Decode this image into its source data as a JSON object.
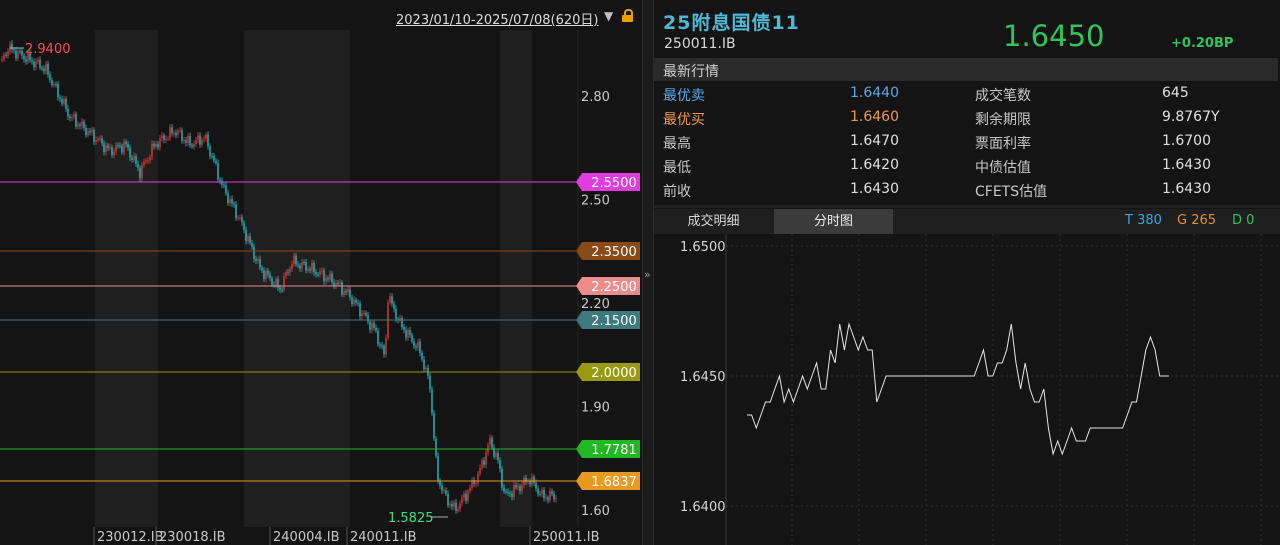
{
  "kline_chart": {
    "header_range": "2023/01/10-2025/07/08(620日)",
    "y_ticks": [
      "2.80",
      "2.50",
      "2.20",
      "1.90",
      "1.60"
    ],
    "x_ticks": [
      "230012.IB",
      "230018.IB",
      "240004.IB",
      "240011.IB",
      "250011.IB"
    ],
    "high_label": "2.9400",
    "low_label": "1.5825",
    "levels": [
      {
        "value": "2.5500",
        "color": "#e23be0"
      },
      {
        "value": "2.3500",
        "color": "#8a4a18"
      },
      {
        "value": "2.2500",
        "color": "#ee8c8c"
      },
      {
        "value": "2.1500",
        "color": "#3c7a7e"
      },
      {
        "value": "2.0000",
        "color": "#9a9a10"
      },
      {
        "value": "1.7781",
        "color": "#22b822"
      },
      {
        "value": "1.6837",
        "color": "#e89a20"
      }
    ],
    "colors": {
      "up": "#e23a3a",
      "down": "#22c0c8",
      "high_label": "#ff4a4a",
      "low_label": "#3ee07a"
    }
  },
  "quote": {
    "name": "25附息国债11",
    "code": "250011.IB",
    "last_price": "1.6450",
    "change": "+0.20BP",
    "section_title": "最新行情",
    "rows": [
      {
        "l1": "最优卖",
        "v1": "1.6440",
        "l2": "成交笔数",
        "v2": "645"
      },
      {
        "l1": "最优买",
        "v1": "1.6460",
        "l2": "剩余期限",
        "v2": "9.8767Y"
      },
      {
        "l1": "最高",
        "v1": "1.6470",
        "l2": "票面利率",
        "v2": "1.6700"
      },
      {
        "l1": "最低",
        "v1": "1.6420",
        "l2": "中债估值",
        "v2": "1.6430"
      },
      {
        "l1": "前收",
        "v1": "1.6430",
        "l2": "CFETS估值",
        "v2": "1.6430"
      }
    ],
    "colors": {
      "sell": "#5aa8e8",
      "buy": "#ef9a4a",
      "up": "#2fc45e"
    }
  },
  "tabs": {
    "detail": "成交明细",
    "intraday": "分时图"
  },
  "counters": {
    "t": "T 380",
    "g": "G 265",
    "d": "D 0"
  },
  "chart_data": {
    "type": "line",
    "title": "",
    "xlabel": "",
    "ylabel": "",
    "ylim": [
      1.6395,
      1.65
    ],
    "y_ticks": [
      "1.6500",
      "1.6450",
      "1.6400"
    ],
    "grid": true,
    "series": [
      {
        "values": [
          1.6435,
          1.6435,
          1.643,
          1.6435,
          1.644,
          1.644,
          1.6445,
          1.645,
          1.644,
          1.6445,
          1.644,
          1.6445,
          1.645,
          1.6445,
          1.645,
          1.6455,
          1.6445,
          1.6445,
          1.646,
          1.6455,
          1.647,
          1.646,
          1.647,
          1.6465,
          1.646,
          1.6465,
          1.646,
          1.646,
          1.644,
          1.6445,
          1.645,
          1.645,
          1.645,
          1.645,
          1.645,
          1.645,
          1.645,
          1.645,
          1.645,
          1.645,
          1.645,
          1.645,
          1.645,
          1.645,
          1.645,
          1.645,
          1.645,
          1.645,
          1.645,
          1.645,
          1.6455,
          1.646,
          1.645,
          1.645,
          1.6455,
          1.6455,
          1.646,
          1.647,
          1.6455,
          1.6445,
          1.6455,
          1.6445,
          1.644,
          1.644,
          1.6445,
          1.643,
          1.642,
          1.6425,
          1.642,
          1.6425,
          1.643,
          1.6425,
          1.6425,
          1.6425,
          1.643,
          1.643,
          1.643,
          1.643,
          1.643,
          1.643,
          1.643,
          1.643,
          1.6435,
          1.644,
          1.644,
          1.645,
          1.646,
          1.6465,
          1.646,
          1.645,
          1.645,
          1.645
        ]
      }
    ]
  }
}
